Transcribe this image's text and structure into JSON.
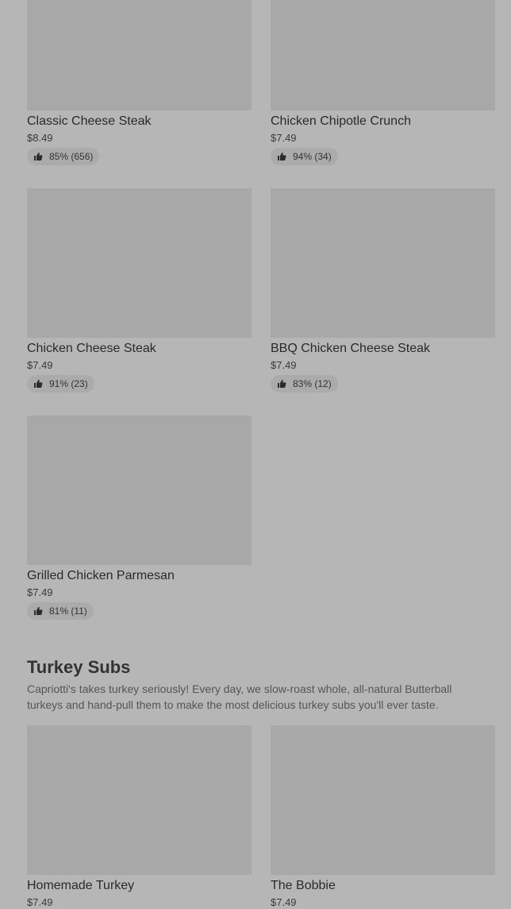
{
  "items_top": [
    {
      "name": "Classic Cheese Steak",
      "price": "$8.49",
      "rating": "85% (656)"
    },
    {
      "name": "Chicken Chipotle Crunch",
      "price": "$7.49",
      "rating": "94% (34)"
    },
    {
      "name": "Chicken Cheese Steak",
      "price": "$7.49",
      "rating": "91% (23)"
    },
    {
      "name": "BBQ Chicken Cheese Steak",
      "price": "$7.49",
      "rating": "83% (12)"
    },
    {
      "name": "Grilled Chicken Parmesan",
      "price": "$7.49",
      "rating": "81% (11)"
    }
  ],
  "turkey_section": {
    "title": "Turkey Subs",
    "description": "Capriotti's takes turkey seriously! Every day, we slow-roast whole, all-natural Butterball turkeys and hand-pull them to make the most delicious turkey subs you'll ever taste.",
    "items": [
      {
        "name": "Homemade Turkey",
        "price": "$7.49"
      },
      {
        "name": "The Bobbie",
        "price": "$7.49"
      }
    ]
  },
  "icons": {
    "rating": "thumbs-up-icon"
  },
  "colors": {
    "background": "#b6b6b6",
    "image_placeholder": "#a8a8a8",
    "rating_pill": "#ababab"
  }
}
